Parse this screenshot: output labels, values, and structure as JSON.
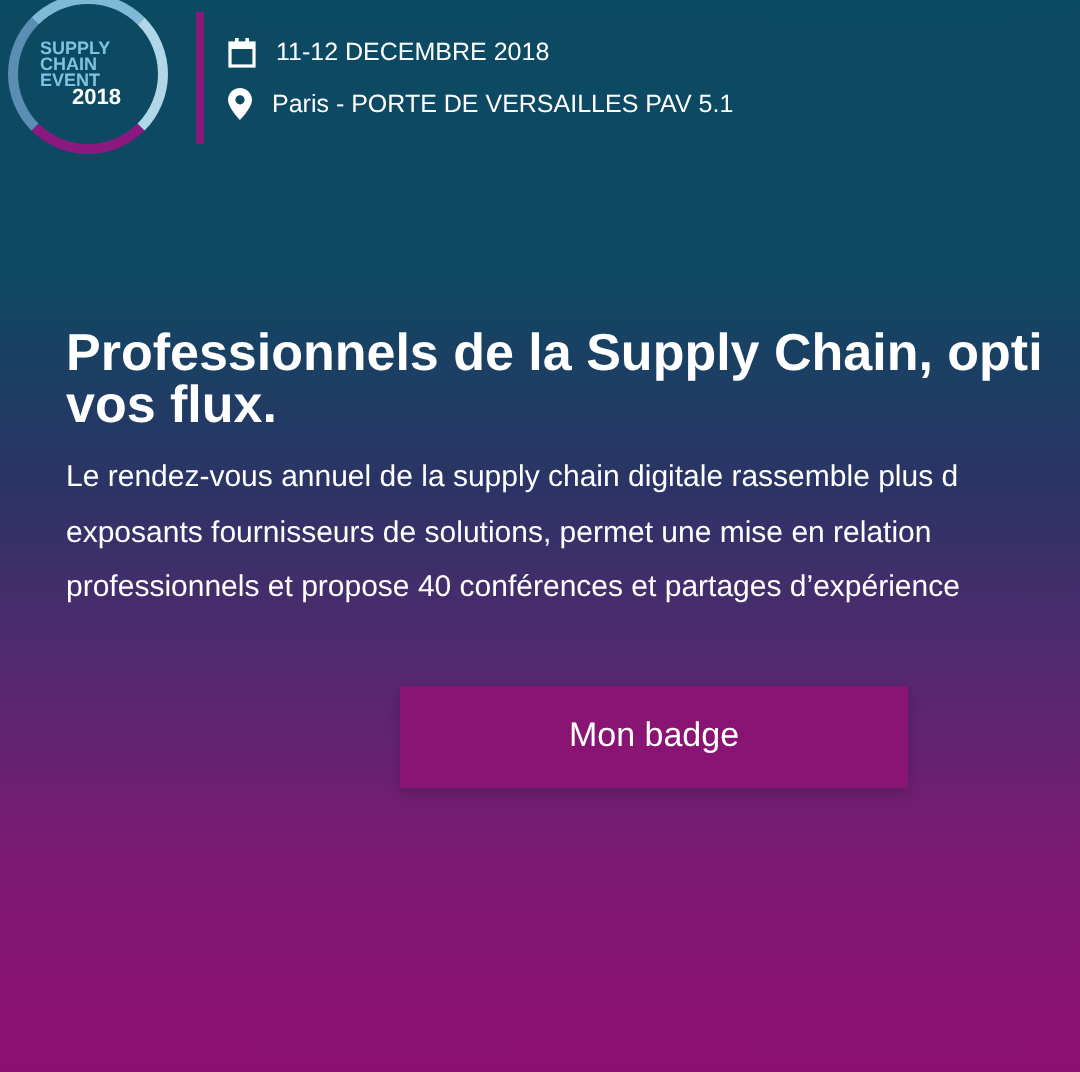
{
  "logo": {
    "lines": [
      "SUPPLY",
      "CHAIN",
      "EVENT"
    ],
    "year": "2018"
  },
  "event": {
    "date": "11-12 DECEMBRE 2018",
    "location": "Paris - PORTE DE VERSAILLES PAV 5.1"
  },
  "hero": {
    "title_lines": [
      "Professionnels de la Supply Chain, opti",
      "vos flux."
    ],
    "description_lines": [
      "Le rendez-vous annuel de la supply chain digitale rassemble plus d",
      "exposants fournisseurs de solutions, permet une mise en relation",
      "professionnels et propose 40 conférences et partages d’expérience"
    ],
    "button": "Mon badge"
  }
}
